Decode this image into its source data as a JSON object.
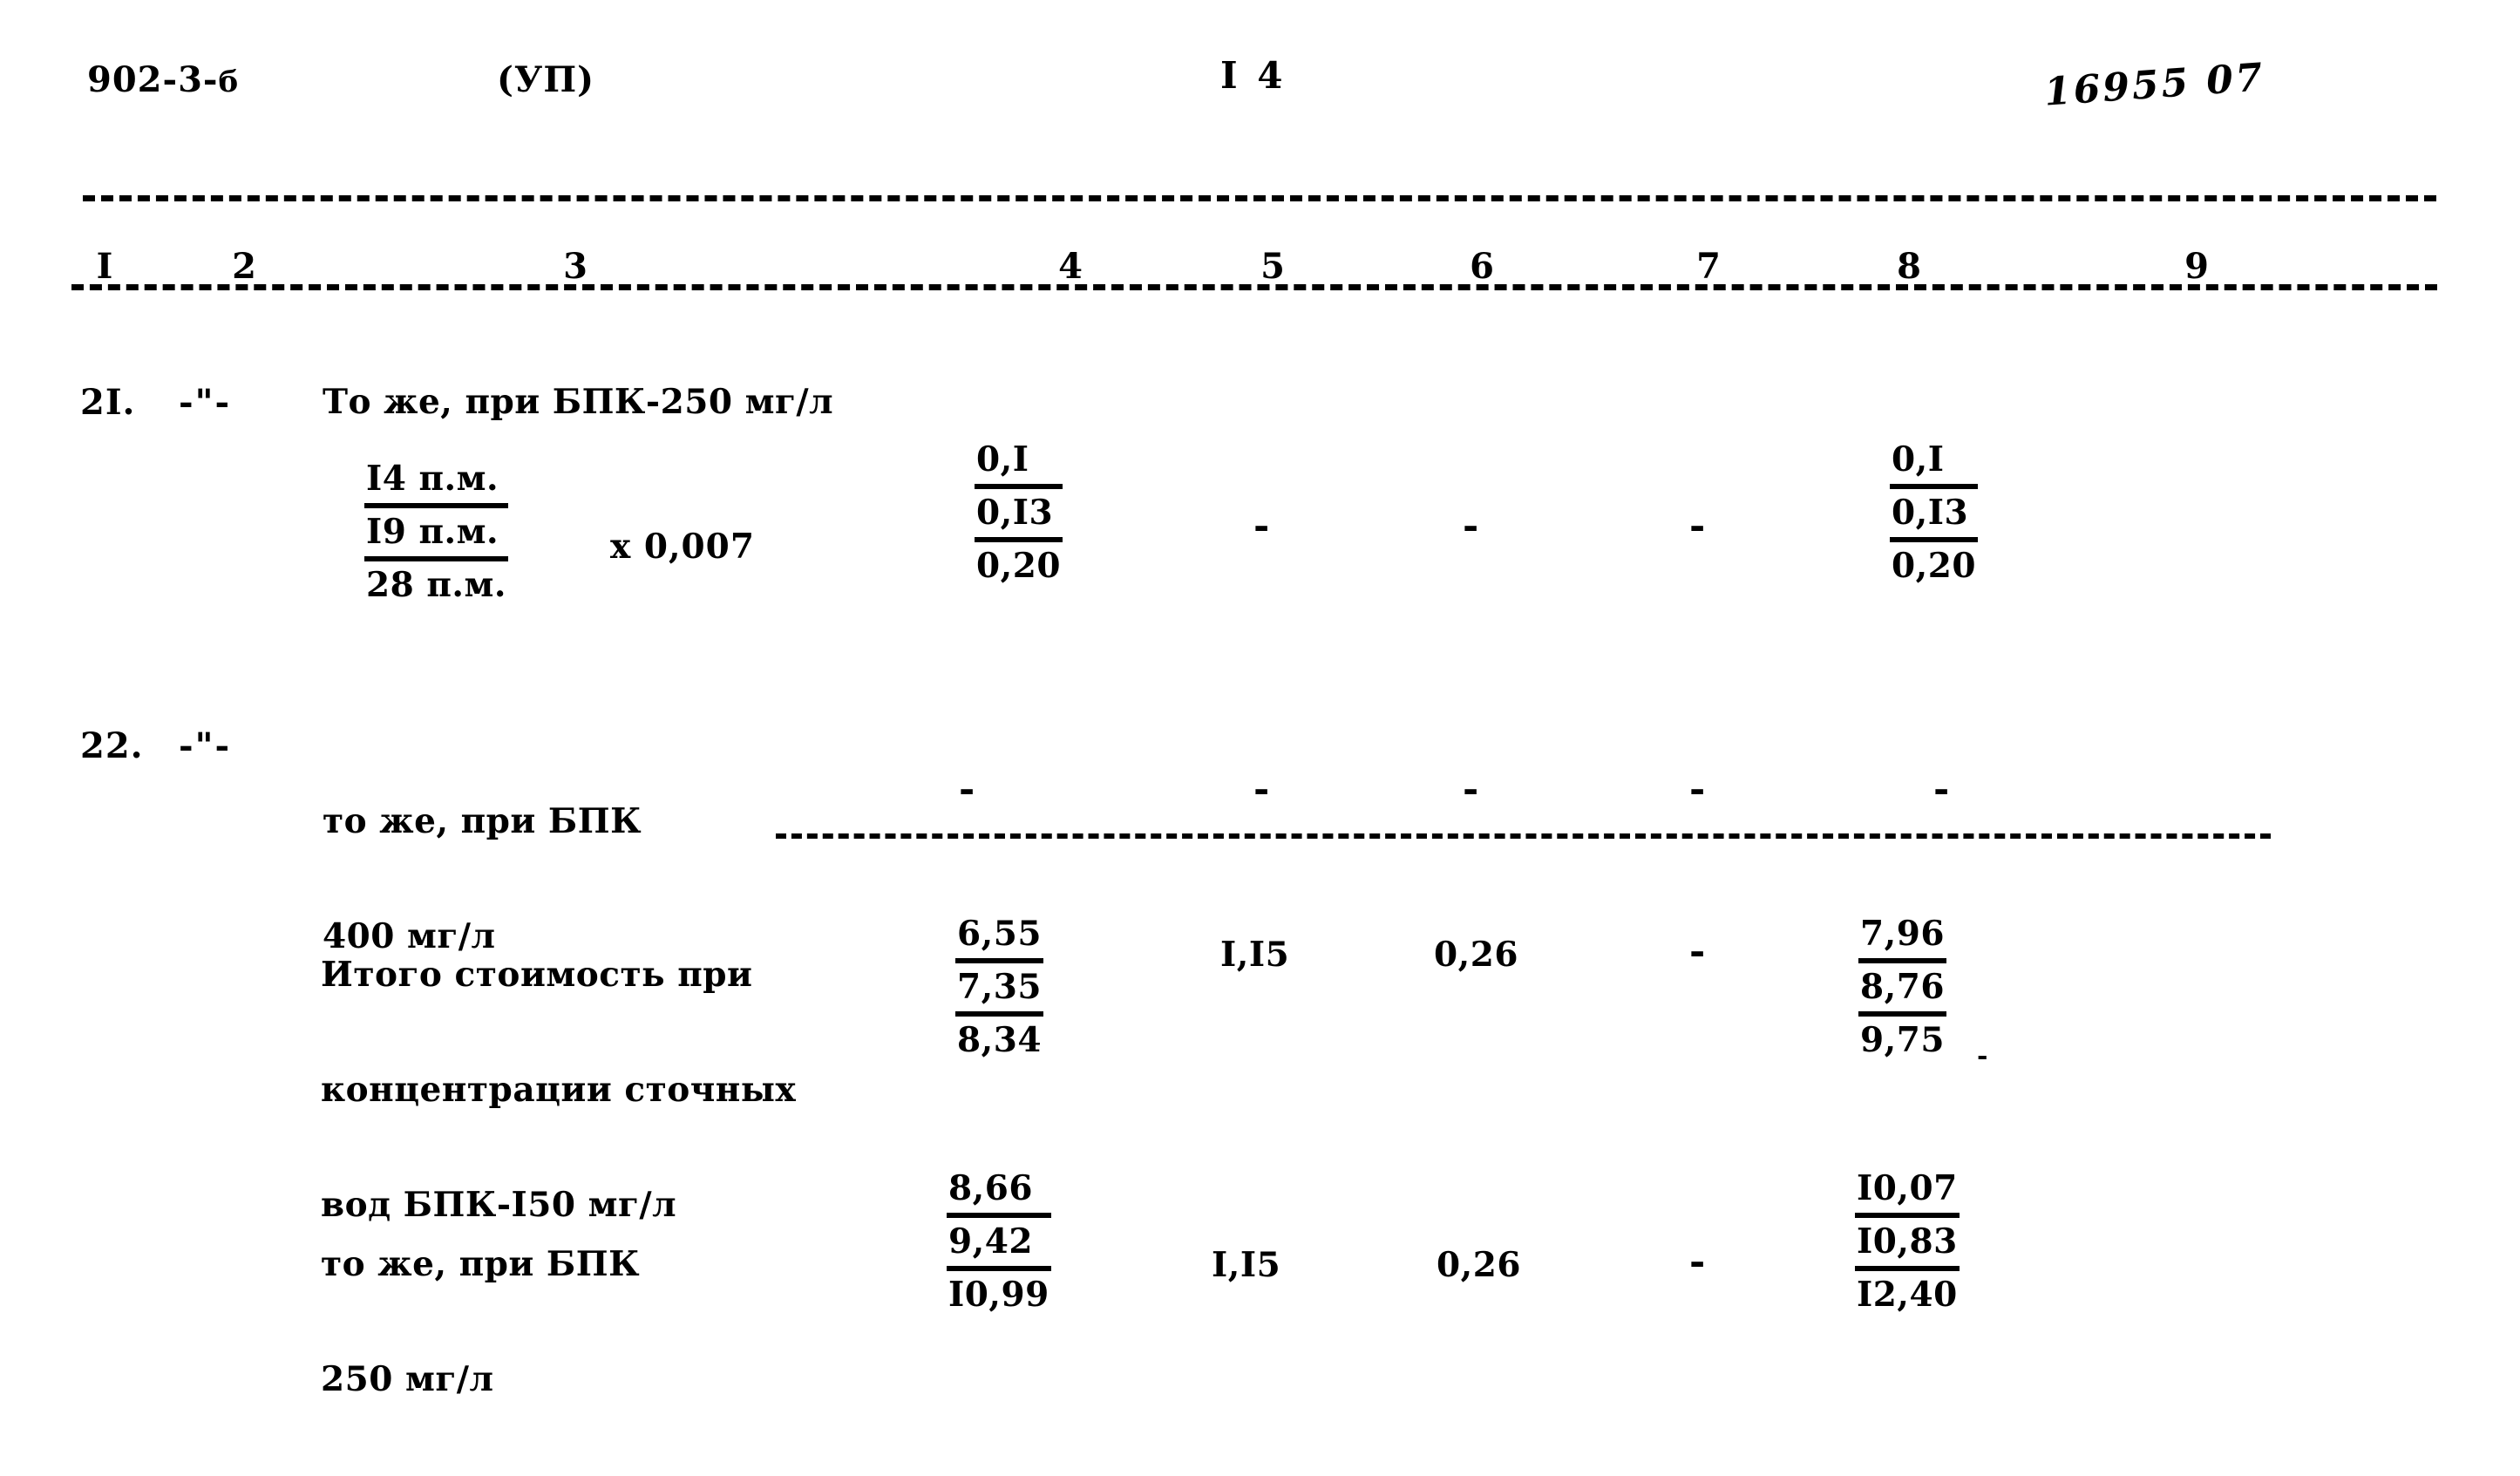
{
  "header": {
    "doc_code": "902-3-",
    "doc_code_suffix": "б",
    "part": "(УП)",
    "page_number": "I 4",
    "stamp": "16955 07"
  },
  "table": {
    "column_numbers": [
      "I",
      "2",
      "3",
      "4",
      "5",
      "6",
      "7",
      "8",
      "9"
    ],
    "rows": [
      {
        "no": "2I.",
        "repeat_mark": "-\"-",
        "description": "То же, при БПК-250 мг/л",
        "formula_lines": [
          "I4 п.м.",
          "I9 п.м.",
          "28 п.м."
        ],
        "multiplier": "х 0,007",
        "col4": [
          "0,I",
          "0,I3",
          "0,20"
        ],
        "col5": "-",
        "col6": "-",
        "col7": "-",
        "col8": [
          "0,I",
          "0,I3",
          "0,20"
        ],
        "col9": ""
      },
      {
        "no": "22.",
        "repeat_mark": "-\"-",
        "description_line1": "то же, при БПК",
        "description_line2": "400 мг/л",
        "col4": "-",
        "col5": "-",
        "col6": "-",
        "col7": "-",
        "col8": "-",
        "col9": ""
      },
      {
        "no": "",
        "repeat_mark": "",
        "description_line1": "Итого стоимость при",
        "description_line2": "концентрации сточных",
        "description_line3": "вод БПК-I50 мг/л",
        "col4": [
          "6,55",
          "7,35",
          "8,34"
        ],
        "col5": "I,I5",
        "col6": "0,26",
        "col7": "-",
        "col8": [
          "7,96",
          "8,76",
          "9,75"
        ],
        "col8_stray": "-",
        "col9": ""
      },
      {
        "no": "",
        "repeat_mark": "",
        "description_line1": "то же, при БПК",
        "description_line2": "250 мг/л",
        "col4": [
          "8,66",
          "9,42",
          "I0,99"
        ],
        "col5": "I,I5",
        "col6": "0,26",
        "col7": "-",
        "col8": [
          "I0,07",
          "I0,83",
          "I2,40"
        ],
        "col9": ""
      }
    ]
  }
}
